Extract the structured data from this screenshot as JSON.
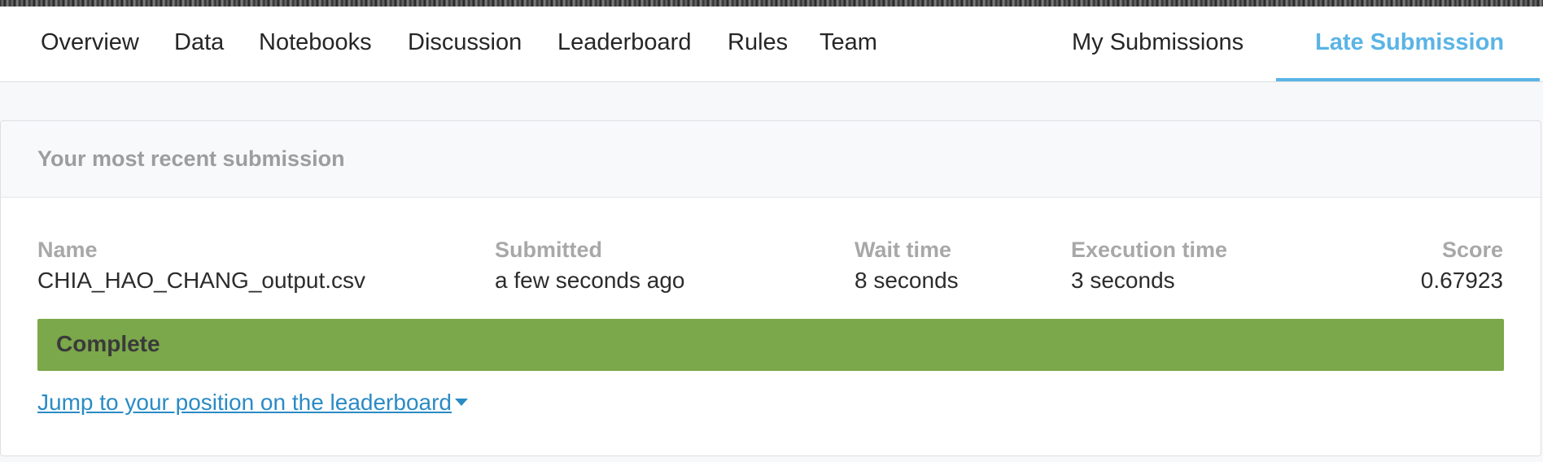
{
  "nav": {
    "tabs": [
      {
        "label": "Overview"
      },
      {
        "label": "Data"
      },
      {
        "label": "Notebooks"
      },
      {
        "label": "Discussion"
      },
      {
        "label": "Leaderboard"
      },
      {
        "label": "Rules"
      },
      {
        "label": "Team"
      }
    ],
    "my_submissions": "My Submissions",
    "late_submission": "Late Submission"
  },
  "submission": {
    "header": "Your most recent submission",
    "columns": {
      "name": {
        "label": "Name",
        "value": "CHIA_HAO_CHANG_output.csv"
      },
      "submitted": {
        "label": "Submitted",
        "value": "a few seconds ago"
      },
      "wait_time": {
        "label": "Wait time",
        "value": "8 seconds"
      },
      "execution_time": {
        "label": "Execution time",
        "value": "3 seconds"
      },
      "score": {
        "label": "Score",
        "value": "0.67923"
      }
    },
    "status": "Complete",
    "jump_link": "Jump to your position on the leaderboard"
  },
  "colors": {
    "accent": "#5ab4e6",
    "status_complete": "#7ba84a",
    "link": "#2a8bc5"
  }
}
